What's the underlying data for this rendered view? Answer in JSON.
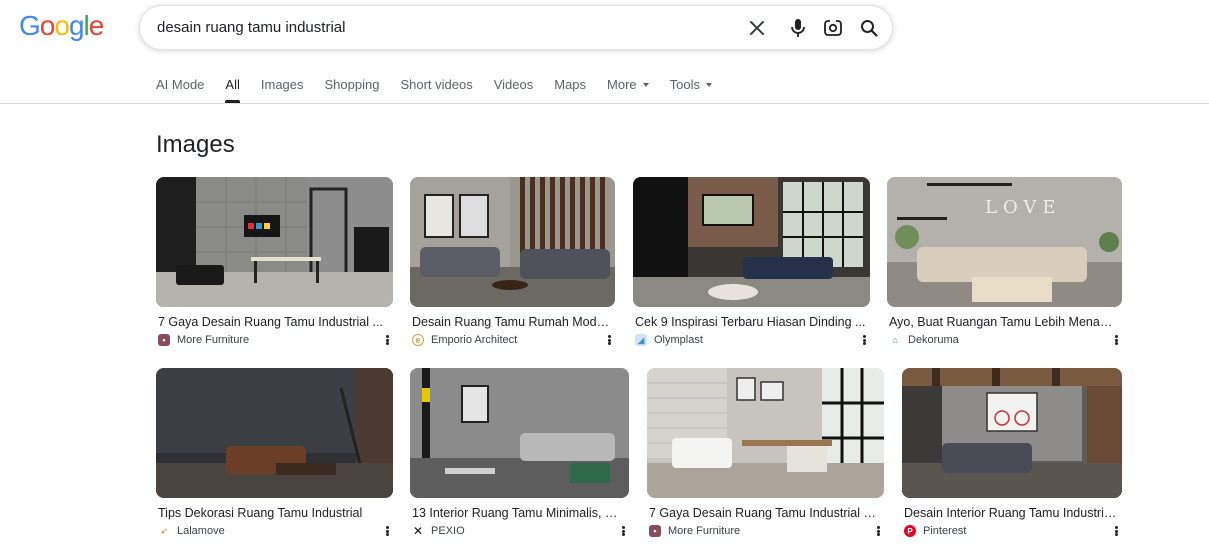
{
  "logo": {
    "letters": [
      "G",
      "o",
      "o",
      "g",
      "l",
      "e"
    ],
    "colors": [
      "#4285F4",
      "#EA4335",
      "#FBBC05",
      "#4285F4",
      "#34A853",
      "#EA4335"
    ]
  },
  "search": {
    "query": "desain ruang tamu industrial"
  },
  "tabs": [
    {
      "label": "AI Mode"
    },
    {
      "label": "All",
      "active": true
    },
    {
      "label": "Images"
    },
    {
      "label": "Shopping"
    },
    {
      "label": "Short videos"
    },
    {
      "label": "Videos"
    },
    {
      "label": "Maps"
    },
    {
      "label": "More",
      "dropdown": true
    },
    {
      "label": "Tools",
      "dropdown": true
    }
  ],
  "section_title": "Images",
  "images": [
    {
      "title": "7 Gaya Desain Ruang Tamu Industrial ...",
      "source": "More Furniture",
      "favicon_color": "#8a4b5a"
    },
    {
      "title": "Desain Ruang Tamu Rumah Mode...",
      "source": "Emporio Architect",
      "favicon_color": "#d4a04a"
    },
    {
      "title": "Cek 9 Inspirasi Terbaru Hiasan Dinding ...",
      "source": "Olymplast",
      "favicon_color": "#7aaed6"
    },
    {
      "title": "Ayo, Buat Ruangan Tamu Lebih Menaw...",
      "source": "Dekoruma",
      "favicon_color": "#4a8fb5"
    },
    {
      "title": "Tips Dekorasi Ruang Tamu Industrial",
      "source": "Lalamove",
      "favicon_color": "#f07a1e"
    },
    {
      "title": "13 Interior Ruang Tamu Minimalis, M...",
      "source": "PEXIO",
      "favicon_color": "#111111"
    },
    {
      "title": "7 Gaya Desain Ruang Tamu Industrial M...",
      "source": "More Furniture",
      "favicon_color": "#8a4b5a"
    },
    {
      "title": "Desain Interior Ruang Tamu Industria...",
      "source": "Pinterest",
      "favicon_color": "#e60023"
    }
  ]
}
